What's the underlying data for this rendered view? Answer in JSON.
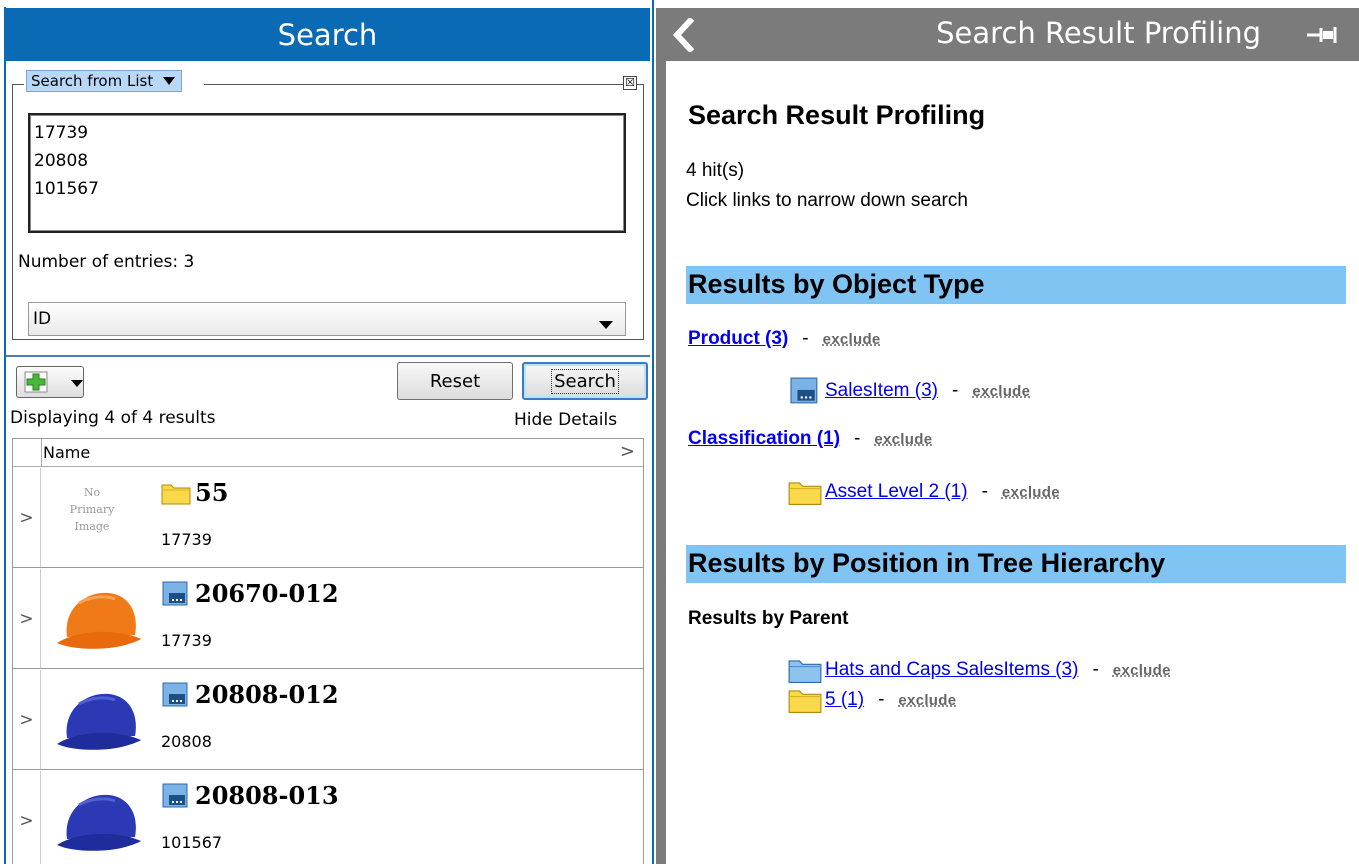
{
  "left_panel": {
    "title": "Search",
    "list_mode": "Search from List",
    "close_glyph": "☒",
    "entries": [
      "17739",
      "20808",
      "101567"
    ],
    "entry_count_text": "Number of entries: 3",
    "id_field": "ID",
    "reset_label": "Reset",
    "search_label": "Search",
    "displaying_text": "Displaying 4 of 4 results",
    "hide_details_label": "Hide Details",
    "grid_header": "Name",
    "grid_more": ">",
    "rows": [
      {
        "chevron": ">",
        "name": "55",
        "id": "17739",
        "icon": "folder-icon",
        "image": "none",
        "no_image_text": [
          "No",
          "Primary",
          "Image"
        ]
      },
      {
        "chevron": ">",
        "name": "20670-012",
        "id": "17739",
        "icon": "salesitem-icon",
        "image": "orange-cap"
      },
      {
        "chevron": ">",
        "name": "20808-012",
        "id": "20808",
        "icon": "salesitem-icon",
        "image": "blue-cap"
      },
      {
        "chevron": ">",
        "name": "20808-013",
        "id": "101567",
        "icon": "salesitem-icon",
        "image": "blue-cap"
      }
    ]
  },
  "right_panel": {
    "header_title": "Search Result Profiling",
    "title": "Search Result Profiling",
    "hits": "4 hit(s)",
    "instructions": "Click links to narrow down search",
    "section_object_type": "Results by Object Type",
    "object_types": [
      {
        "label": "Product (3)",
        "exclude": "exclude"
      },
      {
        "label": "SalesItem (3)",
        "exclude": "exclude",
        "icon": "salesitem-icon"
      },
      {
        "label": "Classification (1)",
        "exclude": "exclude"
      },
      {
        "label": "Asset Level 2 (1)",
        "exclude": "exclude",
        "icon": "folder-icon"
      }
    ],
    "section_tree": "Results by Position in Tree Hierarchy",
    "by_parent": "Results by Parent",
    "parents": [
      {
        "label": "Hats and Caps SalesItems (3)",
        "exclude": "exclude",
        "icon": "blue-folder-icon"
      },
      {
        "label": "5 (1)",
        "exclude": "exclude",
        "icon": "folder-icon"
      }
    ],
    "dash": "-"
  },
  "colors": {
    "left_header": "#0b6ab4",
    "right_header": "#7b7b7b",
    "section_bar": "#80c4f4",
    "link": "#0000ee",
    "cap_orange": "#f07a18",
    "cap_blue": "#2b39b5"
  }
}
